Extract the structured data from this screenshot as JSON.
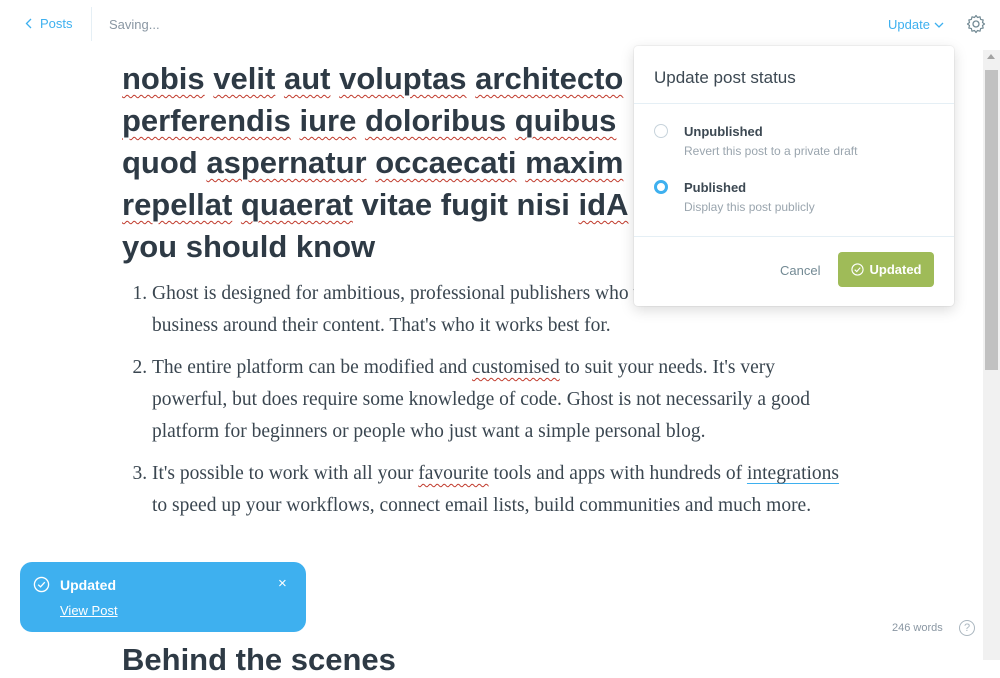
{
  "topbar": {
    "back_label": "Posts",
    "status": "Saving...",
    "update_label": "Update"
  },
  "editor": {
    "title_lines": [
      "nobis velit aut voluptas architecto",
      "perferendis iure doloribus quibus",
      "quod aspernatur occaecati maxim",
      "repellat quaerat vitae fugit nisi idA",
      "you should know"
    ],
    "list_items": [
      {
        "num": "1.",
        "parts": [
          "Ghost is designed for ambitious, professional publishe",
          "rs who want to actively build a business around their content. That's who it works best for."
        ]
      }
    ],
    "item1": "Ghost is designed for ambitious, professional publishers who want to actively build a business around their content. That's who it works best for.",
    "item2_pre": "The entire platform can be modified and ",
    "item2_spell": "customised",
    "item2_post": " to suit your needs. It's very powerful, but does require some knowledge of code. Ghost is not necessarily a good platform for beginners or people who just want a simple personal blog.",
    "item3_pre": "It's possible to work with all your ",
    "item3_spell": "favourite",
    "item3_mid": " tools and apps with hundreds of ",
    "item3_link": "integrations",
    "item3_post": " to speed up your workflows, connect email lists, build communities and much more.",
    "next_heading": "Behind the scenes"
  },
  "popup": {
    "title": "Update post status",
    "options": [
      {
        "label": "Unpublished",
        "desc": "Revert this post to a private draft",
        "selected": false
      },
      {
        "label": "Published",
        "desc": "Display this post publicly",
        "selected": true
      }
    ],
    "cancel_label": "Cancel",
    "confirm_label": "Updated"
  },
  "toast": {
    "title": "Updated",
    "link": "View Post",
    "close": "×"
  },
  "footer": {
    "word_count": "246 words",
    "help": "?"
  },
  "colors": {
    "accent": "#3eb0ef",
    "success": "#9fbb58",
    "heading": "#2e3a45"
  }
}
